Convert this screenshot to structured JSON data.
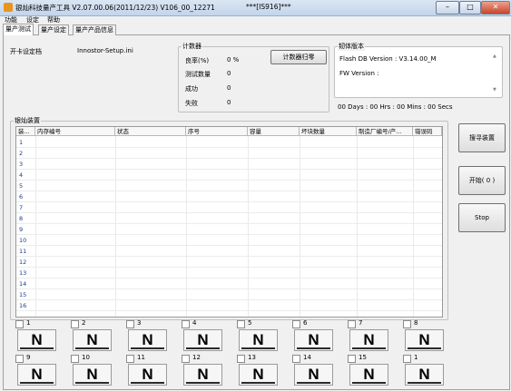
{
  "window": {
    "title": "银灿科技量产工具 V2.07.00.06(2011/12/23)   V106_00_12271",
    "title_suffix": "***[IS916]***",
    "minimize": "–",
    "maximize": "□",
    "close": "✕"
  },
  "menu": [
    "功能",
    "设定",
    "帮助"
  ],
  "tabs": [
    "量产测试",
    "量产设定",
    "量产产品信息"
  ],
  "settings": {
    "label": "开卡设定档",
    "value": "Innostor-Setup.ini"
  },
  "counter": {
    "title": "计数器",
    "rows": [
      {
        "label": "良率(%)",
        "value": "0 %"
      },
      {
        "label": "测试数量",
        "value": "0"
      },
      {
        "label": "成功",
        "value": "0"
      },
      {
        "label": "失败",
        "value": "0"
      }
    ],
    "reset_button": "计数器归零"
  },
  "firmware": {
    "title": "韧体版本",
    "flash_db": "Flash DB Version :  V3.14.00_M",
    "fw": "FW Version :",
    "timer": "00 Days : 00 Hrs : 00 Mins : 00 Secs"
  },
  "devices": {
    "title": "银灿装置",
    "columns": [
      "装...",
      "内存编号",
      "状态",
      "序号",
      "容量",
      "坏块数量",
      "制造厂编号/产...",
      "错误码"
    ],
    "rows": [
      "1",
      "2",
      "3",
      "4",
      "5",
      "6",
      "7",
      "8",
      "9",
      "10",
      "11",
      "12",
      "13",
      "14",
      "15",
      "16"
    ]
  },
  "buttons": {
    "scan": "搜寻装置",
    "start": "开始( 0 )",
    "stop": "Stop"
  },
  "slots": {
    "row1": [
      {
        "num": "1",
        "letter": "N"
      },
      {
        "num": "2",
        "letter": "N"
      },
      {
        "num": "3",
        "letter": "N"
      },
      {
        "num": "4",
        "letter": "N"
      },
      {
        "num": "5",
        "letter": "N"
      },
      {
        "num": "6",
        "letter": "N"
      },
      {
        "num": "7",
        "letter": "N"
      },
      {
        "num": "8",
        "letter": "N"
      }
    ],
    "row2": [
      {
        "num": "9",
        "letter": "N"
      },
      {
        "num": "10",
        "letter": "N"
      },
      {
        "num": "11",
        "letter": "N"
      },
      {
        "num": "12",
        "letter": "N"
      },
      {
        "num": "13",
        "letter": "N"
      },
      {
        "num": "14",
        "letter": "N"
      },
      {
        "num": "15",
        "letter": "N"
      },
      {
        "num": "1",
        "letter": "N"
      }
    ]
  },
  "icons": {
    "app": "app-icon",
    "scroll_up": "▲",
    "scroll_down": "▼"
  }
}
